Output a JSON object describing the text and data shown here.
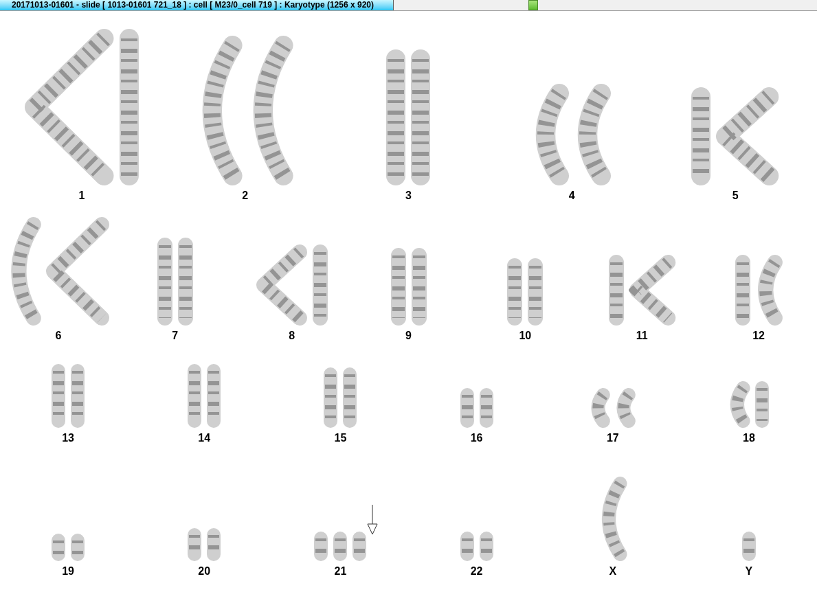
{
  "window": {
    "title": "20171013-01601 - slide [ 1013-01601 721_18 ] : cell [ M23/0_cell 719 ] : Karyotype  (1256 x 920)"
  },
  "karyotype": {
    "rows": [
      {
        "groups": [
          {
            "label": "1",
            "marked": false,
            "homologs": [
              {
                "kind": "bent"
              },
              {
                "kind": "straight"
              }
            ]
          },
          {
            "label": "2",
            "marked": false,
            "homologs": [
              {
                "kind": "curved"
              },
              {
                "kind": "curved"
              }
            ]
          },
          {
            "label": "3",
            "marked": false,
            "homologs": [
              {
                "kind": "straight"
              },
              {
                "kind": "straight"
              }
            ]
          },
          {
            "label": "4",
            "marked": false,
            "homologs": [
              {
                "kind": "curved"
              },
              {
                "kind": "curved"
              }
            ]
          },
          {
            "label": "5",
            "marked": false,
            "homologs": [
              {
                "kind": "straight"
              },
              {
                "kind": "bent"
              }
            ]
          }
        ]
      },
      {
        "groups": [
          {
            "label": "6",
            "marked": false,
            "homologs": [
              {
                "kind": "curved"
              },
              {
                "kind": "bent"
              }
            ]
          },
          {
            "label": "7",
            "marked": false,
            "homologs": [
              {
                "kind": "straight"
              },
              {
                "kind": "straight"
              }
            ]
          },
          {
            "label": "8",
            "marked": false,
            "homologs": [
              {
                "kind": "bent"
              },
              {
                "kind": "straight"
              }
            ]
          },
          {
            "label": "9",
            "marked": false,
            "homologs": [
              {
                "kind": "straight"
              },
              {
                "kind": "straight"
              }
            ]
          },
          {
            "label": "10",
            "marked": false,
            "homologs": [
              {
                "kind": "straight"
              },
              {
                "kind": "straight"
              }
            ]
          },
          {
            "label": "11",
            "marked": false,
            "homologs": [
              {
                "kind": "straight"
              },
              {
                "kind": "bent"
              }
            ]
          },
          {
            "label": "12",
            "marked": false,
            "homologs": [
              {
                "kind": "straight"
              },
              {
                "kind": "curved"
              }
            ]
          }
        ]
      },
      {
        "groups": [
          {
            "label": "13",
            "marked": false,
            "homologs": [
              {
                "kind": "straight"
              },
              {
                "kind": "straight"
              }
            ]
          },
          {
            "label": "14",
            "marked": false,
            "homologs": [
              {
                "kind": "straight"
              },
              {
                "kind": "straight"
              }
            ]
          },
          {
            "label": "15",
            "marked": false,
            "homologs": [
              {
                "kind": "straight"
              },
              {
                "kind": "straight"
              }
            ]
          },
          {
            "label": "16",
            "marked": false,
            "homologs": [
              {
                "kind": "straight"
              },
              {
                "kind": "straight"
              }
            ]
          },
          {
            "label": "17",
            "marked": false,
            "homologs": [
              {
                "kind": "curved"
              },
              {
                "kind": "curved"
              }
            ]
          },
          {
            "label": "18",
            "marked": false,
            "homologs": [
              {
                "kind": "curved"
              },
              {
                "kind": "straight"
              }
            ]
          }
        ]
      },
      {
        "groups": [
          {
            "label": "19",
            "marked": false,
            "homologs": [
              {
                "kind": "straight"
              },
              {
                "kind": "straight"
              }
            ]
          },
          {
            "label": "20",
            "marked": false,
            "homologs": [
              {
                "kind": "straight"
              },
              {
                "kind": "straight"
              }
            ]
          },
          {
            "label": "21",
            "marked": true,
            "homologs": [
              {
                "kind": "straight"
              },
              {
                "kind": "straight"
              },
              {
                "kind": "straight"
              }
            ]
          },
          {
            "label": "22",
            "marked": false,
            "homologs": [
              {
                "kind": "straight"
              },
              {
                "kind": "straight"
              }
            ]
          },
          {
            "label": "X",
            "marked": false,
            "homologs": [
              {
                "kind": "curved"
              }
            ]
          },
          {
            "label": "Y",
            "marked": false,
            "homologs": [
              {
                "kind": "straight"
              }
            ]
          }
        ]
      }
    ]
  }
}
